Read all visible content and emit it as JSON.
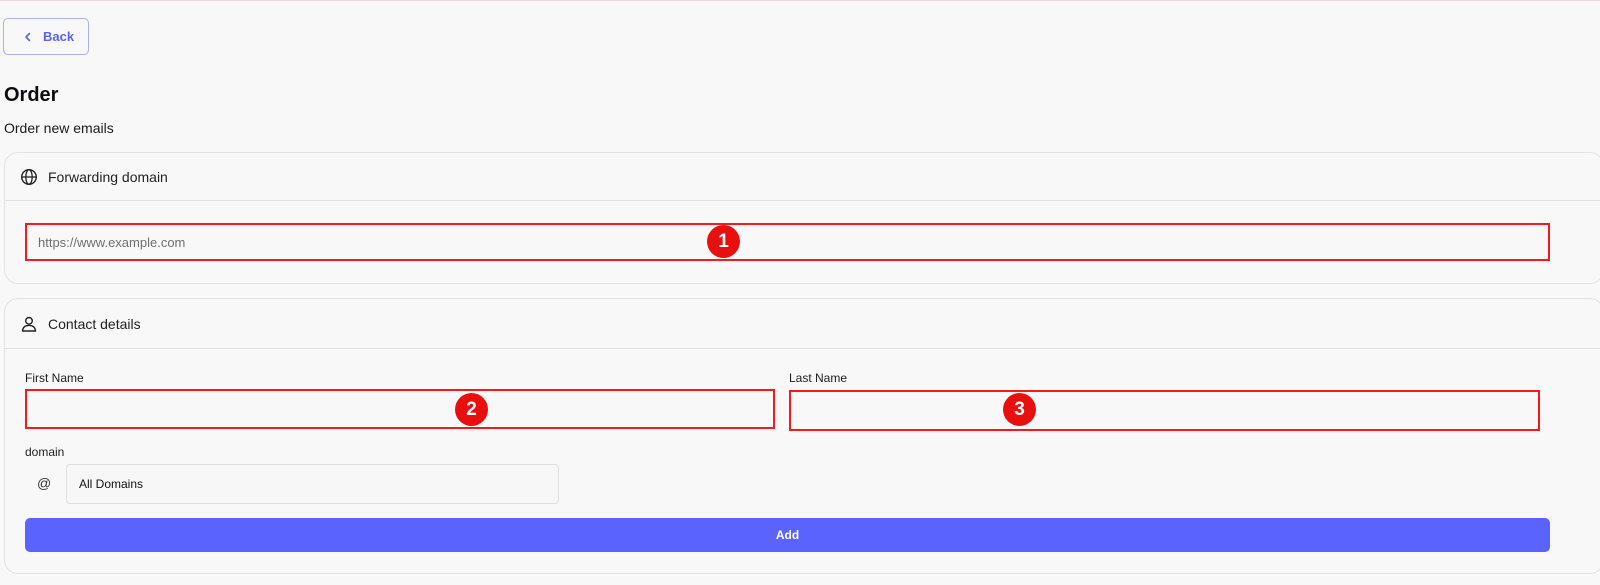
{
  "nav": {
    "back_label": "Back"
  },
  "page": {
    "title": "Order",
    "subtitle": "Order new emails"
  },
  "forwarding": {
    "section_title": "Forwarding domain",
    "url_placeholder": "https://www.example.com",
    "url_value": "",
    "annotation": "1"
  },
  "contact": {
    "section_title": "Contact details",
    "first_name_label": "First Name",
    "first_name_value": "",
    "first_name_annotation": "2",
    "last_name_label": "Last Name",
    "last_name_value": "",
    "last_name_annotation": "3",
    "domain_label": "domain",
    "domain_prefix": "@",
    "domain_selected": "All Domains",
    "add_label": "Add"
  },
  "colors": {
    "accent": "#5b63fe",
    "annotation_border": "#f21a1a",
    "annotation_badge": "#e8100f"
  }
}
